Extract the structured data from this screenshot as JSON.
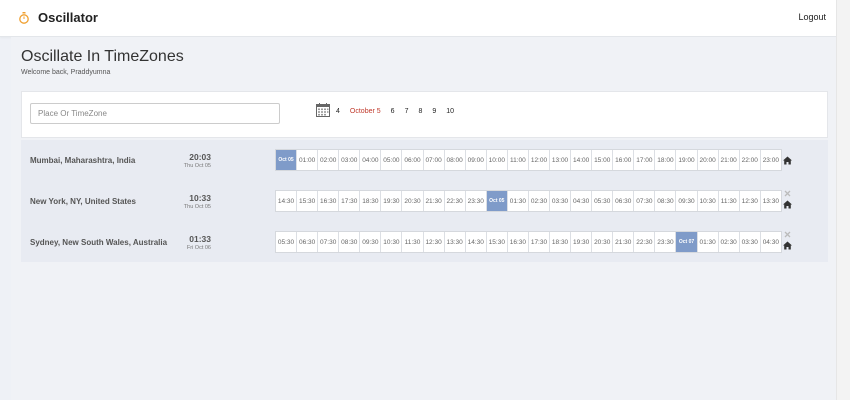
{
  "app": {
    "name": "Oscillator",
    "logout_label": "Logout"
  },
  "page": {
    "title": "Oscillate In TimeZones",
    "welcome": "Welcome back, Praddyumna"
  },
  "search": {
    "placeholder": "Place Or TimeZone",
    "value": ""
  },
  "dates": [
    "4",
    "October 5",
    "6",
    "7",
    "8",
    "9",
    "10"
  ],
  "active_date": "October 5",
  "colors": {
    "highlight": "#7f9bc9",
    "active_date": "#c0392b"
  },
  "timezones": [
    {
      "name": "Mumbai, Maharashtra, India",
      "time": "20:03",
      "date": "Thu Oct 05",
      "hours": [
        "Oct 05",
        "01:00",
        "02:00",
        "03:00",
        "04:00",
        "05:00",
        "06:00",
        "07:00",
        "08:00",
        "09:00",
        "10:00",
        "11:00",
        "12:00",
        "13:00",
        "14:00",
        "15:00",
        "16:00",
        "17:00",
        "18:00",
        "19:00",
        "20:00",
        "21:00",
        "22:00",
        "23:00"
      ],
      "day_index": 0,
      "icons": [
        "home-icon"
      ]
    },
    {
      "name": "New York, NY, United States",
      "time": "10:33",
      "date": "Thu Oct 05",
      "hours": [
        "14:30",
        "15:30",
        "16:30",
        "17:30",
        "18:30",
        "19:30",
        "20:30",
        "21:30",
        "22:30",
        "23:30",
        "Oct 05",
        "01:30",
        "02:30",
        "03:30",
        "04:30",
        "05:30",
        "06:30",
        "07:30",
        "08:30",
        "09:30",
        "10:30",
        "11:30",
        "12:30",
        "13:30"
      ],
      "day_index": 10,
      "icons": [
        "close-icon",
        "home-icon"
      ]
    },
    {
      "name": "Sydney, New South Wales, Australia",
      "time": "01:33",
      "date": "Fri Oct 06",
      "hours": [
        "05:30",
        "06:30",
        "07:30",
        "08:30",
        "09:30",
        "10:30",
        "11:30",
        "12:30",
        "13:30",
        "14:30",
        "15:30",
        "16:30",
        "17:30",
        "18:30",
        "19:30",
        "20:30",
        "21:30",
        "22:30",
        "23:30",
        "Oct 07",
        "01:30",
        "02:30",
        "03:30",
        "04:30"
      ],
      "day_index": 19,
      "icons": [
        "close-icon",
        "home-icon"
      ]
    }
  ]
}
